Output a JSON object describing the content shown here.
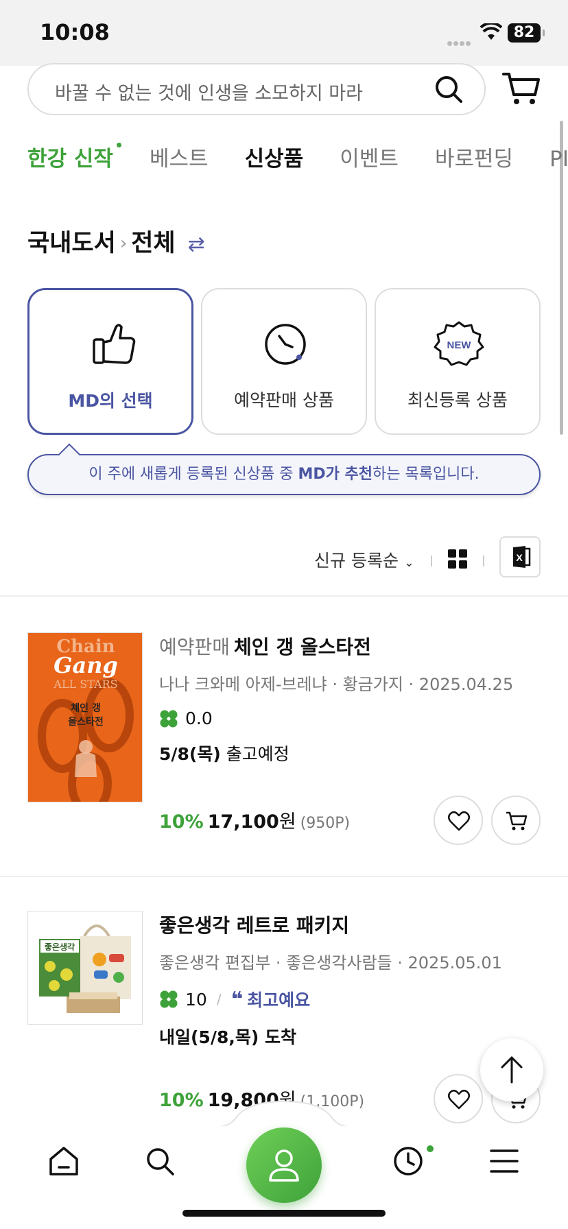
{
  "status": {
    "time": "10:08",
    "battery": "82"
  },
  "search": {
    "placeholder": "바꿀 수 없는 것에 인생을 소모하지 마라"
  },
  "tabs": [
    {
      "label": "한강 신작"
    },
    {
      "label": "베스트"
    },
    {
      "label": "신상품"
    },
    {
      "label": "이벤트"
    },
    {
      "label": "바로펀딩"
    },
    {
      "label": "PIC"
    }
  ],
  "breadcrumb": {
    "level1": "국내도서",
    "level2": "전체"
  },
  "categories": [
    {
      "label": "MD의 선택"
    },
    {
      "label": "예약판매 상품"
    },
    {
      "label": "최신등록 상품"
    }
  ],
  "new_badge": "NEW",
  "tooltip": {
    "pre": "이 주에 새롭게 등록된 신상품 중 ",
    "bold": "MD가 추천",
    "post": "하는 목록입니다."
  },
  "sort": {
    "label": "신규 등록순"
  },
  "colors": {
    "accent_green": "#3ea23a",
    "accent_navy": "#4a55a2"
  },
  "products": [
    {
      "prefix": "예약판매",
      "title": "체인 갱 올스타전",
      "meta": "나나 크와메 아제-브레냐 · 황금가지 · 2025.04.25",
      "rating": "0.0",
      "ship_bold": "5/8(목)",
      "ship_rest": " 출고예정",
      "discount": "10%",
      "price": "17,100",
      "won": "원",
      "points": "(950P)",
      "cover_text1": "Chain",
      "cover_text2": "Gang",
      "cover_text3": "ALL STARS",
      "cover_text4": "체인 갱",
      "cover_text5": "올스타전"
    },
    {
      "prefix": "",
      "title": "좋은생각 레트로 패키지",
      "meta": "좋은생각 편집부 · 좋은생각사람들 · 2025.05.01",
      "rating": "10",
      "review": "최고예요",
      "ship_bold": "내일(5/8,목) 도착",
      "ship_rest": "",
      "discount": "10%",
      "price": "19,800",
      "won": "원",
      "points": "(1,100P)",
      "cover_text1": "좋은생각"
    }
  ],
  "icons": [
    "search-icon",
    "cart-icon",
    "thumbs-up-icon",
    "clock-icon",
    "new-badge-icon",
    "swap-icon",
    "grid-icon",
    "excel-icon",
    "clover-icon",
    "quote-icon",
    "heart-icon",
    "home-icon",
    "profile-icon",
    "history-icon",
    "menu-icon",
    "arrow-up-icon"
  ]
}
